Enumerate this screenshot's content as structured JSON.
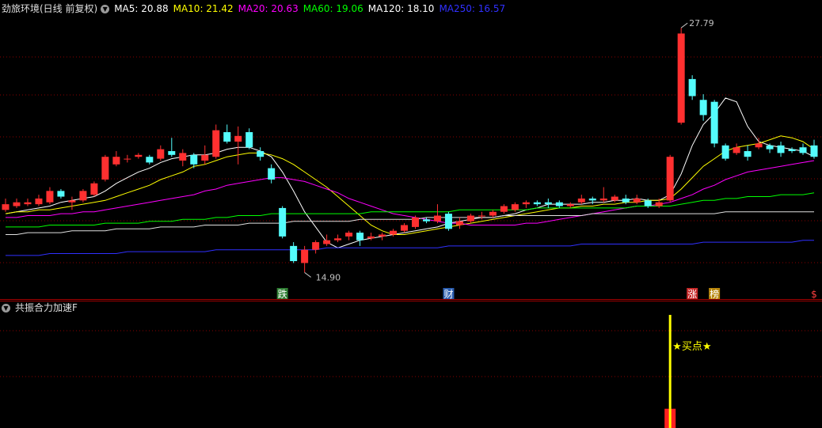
{
  "header": {
    "title": "劲旅环境(日线 前复权)",
    "ma_items": [
      {
        "label": "MA5: 20.88",
        "color": "#ffffff"
      },
      {
        "label": "MA10: 21.42",
        "color": "#ffff00"
      },
      {
        "label": "MA20: 20.63",
        "color": "#ff00ff"
      },
      {
        "label": "MA60: 19.06",
        "color": "#00ff00"
      },
      {
        "label": "MA120: 18.10",
        "color": "#ffffff"
      },
      {
        "label": "MA250: 16.57",
        "color": "#3030ff"
      }
    ]
  },
  "sub_header": {
    "title": "共振合力加速F"
  },
  "colors": {
    "up": "#ff3030",
    "down": "#54fcfc",
    "grid": "#8a0000",
    "signal": "#ffff00"
  },
  "chart_data": {
    "type": "candlestick",
    "price_range": [
      13.5,
      28.6
    ],
    "annotations": {
      "high": "27.79",
      "low": "14.90"
    },
    "event_markers": [
      {
        "index": 25,
        "text": "跌",
        "color": "#ffffff",
        "bg": "#2e7d32"
      },
      {
        "index": 40,
        "text": "财",
        "color": "#ffffff",
        "bg": "#2a5db0"
      },
      {
        "index": 62,
        "text": "涨",
        "color": "#ffffff",
        "bg": "#c62828"
      },
      {
        "index": 64,
        "text": "榜",
        "color": "#ffffff",
        "bg": "#b8860b"
      },
      {
        "index": 73,
        "text": "$",
        "color": "#ff4040",
        "bg": ""
      }
    ],
    "candles": [
      [
        18.2,
        18.5,
        18.8,
        18.1
      ],
      [
        18.4,
        18.6,
        18.8,
        18.3
      ],
      [
        18.5,
        18.6,
        18.8,
        18.4
      ],
      [
        18.5,
        18.8,
        19.0,
        18.4
      ],
      [
        18.6,
        19.2,
        19.4,
        18.5
      ],
      [
        19.2,
        18.9,
        19.3,
        18.8
      ],
      [
        18.6,
        18.7,
        18.9,
        18.2
      ],
      [
        18.7,
        19.2,
        19.3,
        18.6
      ],
      [
        19.0,
        19.6,
        19.7,
        18.9
      ],
      [
        19.8,
        21.0,
        21.1,
        19.7
      ],
      [
        20.6,
        21.0,
        21.3,
        20.5
      ],
      [
        20.9,
        20.9,
        21.1,
        20.7
      ],
      [
        21.0,
        21.1,
        21.2,
        20.9
      ],
      [
        21.0,
        20.7,
        21.1,
        20.6
      ],
      [
        20.9,
        21.4,
        21.6,
        20.8
      ],
      [
        21.3,
        21.1,
        22.0,
        21.0
      ],
      [
        20.8,
        21.2,
        21.4,
        20.5
      ],
      [
        21.1,
        20.6,
        21.2,
        20.4
      ],
      [
        20.8,
        21.1,
        21.6,
        20.6
      ],
      [
        21.0,
        22.4,
        22.7,
        20.9
      ],
      [
        22.3,
        21.8,
        22.7,
        21.7
      ],
      [
        21.8,
        22.1,
        22.6,
        20.6
      ],
      [
        22.3,
        21.5,
        22.5,
        21.4
      ],
      [
        21.3,
        21.0,
        21.5,
        20.8
      ],
      [
        20.4,
        19.8,
        20.6,
        19.6
      ],
      [
        18.3,
        16.8,
        18.4,
        16.7
      ],
      [
        16.3,
        15.5,
        16.5,
        15.4
      ],
      [
        15.4,
        16.1,
        16.3,
        14.9
      ],
      [
        16.1,
        16.5,
        16.6,
        15.9
      ],
      [
        16.4,
        16.6,
        16.9,
        16.3
      ],
      [
        16.6,
        16.7,
        16.9,
        16.5
      ],
      [
        16.8,
        17.0,
        17.1,
        16.6
      ],
      [
        17.0,
        16.6,
        17.1,
        16.3
      ],
      [
        16.7,
        16.8,
        17.0,
        16.6
      ],
      [
        16.8,
        16.9,
        17.0,
        16.6
      ],
      [
        16.9,
        17.1,
        17.2,
        16.8
      ],
      [
        17.1,
        17.4,
        17.5,
        17.0
      ],
      [
        17.3,
        17.8,
        17.9,
        17.2
      ],
      [
        17.7,
        17.6,
        17.8,
        17.5
      ],
      [
        17.6,
        17.9,
        18.5,
        17.5
      ],
      [
        18.0,
        17.2,
        18.1,
        17.1
      ],
      [
        17.4,
        17.6,
        17.8,
        17.2
      ],
      [
        17.6,
        17.9,
        18.0,
        17.5
      ],
      [
        17.9,
        17.9,
        18.1,
        17.7
      ],
      [
        17.9,
        18.1,
        18.2,
        17.8
      ],
      [
        18.1,
        18.4,
        18.5,
        18.0
      ],
      [
        18.2,
        18.5,
        18.6,
        18.1
      ],
      [
        18.5,
        18.6,
        18.7,
        18.3
      ],
      [
        18.6,
        18.5,
        18.7,
        18.4
      ],
      [
        18.6,
        18.5,
        18.8,
        18.3
      ],
      [
        18.6,
        18.4,
        18.7,
        18.3
      ],
      [
        18.4,
        18.5,
        18.6,
        18.3
      ],
      [
        18.6,
        18.8,
        19.0,
        18.5
      ],
      [
        18.8,
        18.7,
        18.9,
        18.5
      ],
      [
        18.7,
        18.8,
        19.4,
        18.6
      ],
      [
        18.7,
        18.9,
        19.0,
        18.6
      ],
      [
        18.8,
        18.6,
        19.0,
        18.5
      ],
      [
        18.6,
        18.8,
        19.0,
        18.5
      ],
      [
        18.7,
        18.4,
        18.8,
        18.3
      ],
      [
        18.4,
        18.6,
        18.8,
        18.3
      ],
      [
        18.7,
        21.0,
        21.1,
        18.6
      ],
      [
        22.8,
        27.5,
        27.8,
        22.7
      ],
      [
        25.1,
        24.2,
        25.3,
        24.0
      ],
      [
        24.0,
        23.2,
        24.3,
        22.9
      ],
      [
        23.9,
        21.7,
        24.0,
        21.5
      ],
      [
        21.6,
        20.9,
        21.7,
        20.8
      ],
      [
        21.2,
        21.5,
        21.7,
        21.1
      ],
      [
        21.3,
        21.0,
        21.6,
        20.8
      ],
      [
        21.5,
        21.7,
        22.0,
        21.4
      ],
      [
        21.6,
        21.4,
        21.7,
        21.2
      ],
      [
        21.6,
        21.2,
        21.8,
        21.0
      ],
      [
        21.4,
        21.3,
        21.5,
        21.2
      ],
      [
        21.5,
        21.2,
        21.7,
        21.1
      ],
      [
        21.6,
        21.0,
        21.9,
        20.9
      ]
    ],
    "ma_series": [
      {
        "color": "#ffffff",
        "values": [
          18.0,
          18.1,
          18.2,
          18.3,
          18.4,
          18.6,
          18.7,
          18.8,
          18.9,
          19.2,
          19.6,
          19.9,
          20.2,
          20.4,
          20.7,
          20.9,
          21.0,
          21.1,
          21.1,
          21.2,
          21.4,
          21.5,
          21.5,
          21.3,
          21.0,
          20.2,
          19.2,
          18.1,
          17.3,
          16.5,
          16.2,
          16.4,
          16.6,
          16.7,
          16.8,
          16.9,
          17.0,
          17.1,
          17.2,
          17.3,
          17.5,
          17.6,
          17.7,
          17.8,
          17.8,
          17.9,
          18.0,
          18.2,
          18.3,
          18.5,
          18.5,
          18.5,
          18.5,
          18.6,
          18.6,
          18.7,
          18.7,
          18.8,
          18.7,
          18.7,
          19.0,
          20.1,
          21.6,
          22.7,
          23.3,
          24.1,
          23.9,
          22.6,
          21.8,
          21.6,
          21.5,
          21.4,
          21.3,
          21.0
        ]
      },
      {
        "color": "#ffff00",
        "values": [
          18.0,
          18.1,
          18.1,
          18.2,
          18.2,
          18.3,
          18.4,
          18.5,
          18.6,
          18.7,
          18.9,
          19.1,
          19.3,
          19.5,
          19.8,
          20.0,
          20.2,
          20.5,
          20.6,
          20.8,
          21.0,
          21.1,
          21.2,
          21.2,
          21.1,
          20.9,
          20.6,
          20.2,
          19.8,
          19.4,
          18.9,
          18.4,
          17.9,
          17.4,
          17.1,
          16.9,
          16.9,
          17.0,
          17.1,
          17.2,
          17.3,
          17.4,
          17.5,
          17.6,
          17.7,
          17.8,
          17.9,
          18.0,
          18.1,
          18.2,
          18.3,
          18.3,
          18.4,
          18.4,
          18.5,
          18.5,
          18.6,
          18.6,
          18.7,
          18.7,
          18.8,
          19.3,
          19.9,
          20.5,
          20.9,
          21.3,
          21.5,
          21.6,
          21.7,
          21.9,
          22.1,
          22.0,
          21.8,
          21.4
        ]
      },
      {
        "color": "#ff00ff",
        "values": [
          17.8,
          17.8,
          17.9,
          17.9,
          17.9,
          18.0,
          18.0,
          18.1,
          18.1,
          18.2,
          18.3,
          18.4,
          18.5,
          18.6,
          18.7,
          18.8,
          18.9,
          19.0,
          19.2,
          19.3,
          19.5,
          19.6,
          19.7,
          19.8,
          19.9,
          19.9,
          19.8,
          19.7,
          19.5,
          19.3,
          19.1,
          18.8,
          18.6,
          18.4,
          18.2,
          18.0,
          17.9,
          17.8,
          17.7,
          17.6,
          17.5,
          17.5,
          17.4,
          17.4,
          17.4,
          17.4,
          17.4,
          17.5,
          17.5,
          17.6,
          17.7,
          17.8,
          17.9,
          18.0,
          18.1,
          18.2,
          18.3,
          18.4,
          18.4,
          18.5,
          18.6,
          18.8,
          19.0,
          19.3,
          19.5,
          19.8,
          20.0,
          20.2,
          20.3,
          20.4,
          20.5,
          20.6,
          20.7,
          20.8
        ]
      },
      {
        "color": "#00ff00",
        "values": [
          17.3,
          17.3,
          17.3,
          17.3,
          17.4,
          17.4,
          17.4,
          17.4,
          17.4,
          17.5,
          17.5,
          17.5,
          17.5,
          17.6,
          17.6,
          17.6,
          17.7,
          17.7,
          17.7,
          17.8,
          17.8,
          17.9,
          17.9,
          17.9,
          18.0,
          18.0,
          18.0,
          18.0,
          18.0,
          18.0,
          18.0,
          18.0,
          18.0,
          18.1,
          18.1,
          18.1,
          18.1,
          18.1,
          18.1,
          18.1,
          18.1,
          18.2,
          18.2,
          18.2,
          18.2,
          18.2,
          18.2,
          18.2,
          18.3,
          18.3,
          18.3,
          18.3,
          18.3,
          18.3,
          18.3,
          18.3,
          18.3,
          18.4,
          18.4,
          18.4,
          18.4,
          18.5,
          18.6,
          18.7,
          18.7,
          18.8,
          18.8,
          18.9,
          18.9,
          18.9,
          19.0,
          19.0,
          19.0,
          19.1
        ]
      },
      {
        "color": "#e0e0e0",
        "values": [
          16.9,
          16.9,
          17.0,
          17.0,
          17.0,
          17.0,
          17.1,
          17.1,
          17.1,
          17.1,
          17.2,
          17.2,
          17.2,
          17.2,
          17.3,
          17.3,
          17.3,
          17.3,
          17.4,
          17.4,
          17.4,
          17.4,
          17.5,
          17.5,
          17.5,
          17.5,
          17.6,
          17.6,
          17.6,
          17.6,
          17.6,
          17.6,
          17.7,
          17.7,
          17.7,
          17.7,
          17.7,
          17.7,
          17.8,
          17.8,
          17.8,
          17.8,
          17.8,
          17.8,
          17.8,
          17.9,
          17.9,
          17.9,
          17.9,
          17.9,
          17.9,
          17.9,
          17.9,
          18.0,
          18.0,
          18.0,
          18.0,
          18.0,
          18.0,
          18.0,
          18.0,
          18.0,
          18.0,
          18.0,
          18.0,
          18.1,
          18.1,
          18.1,
          18.1,
          18.1,
          18.1,
          18.1,
          18.1,
          18.1
        ]
      },
      {
        "color": "#3030ff",
        "values": [
          15.8,
          15.8,
          15.8,
          15.8,
          15.9,
          15.9,
          15.9,
          15.9,
          15.9,
          15.9,
          15.9,
          16.0,
          16.0,
          16.0,
          16.0,
          16.0,
          16.0,
          16.0,
          16.0,
          16.1,
          16.1,
          16.1,
          16.1,
          16.1,
          16.1,
          16.1,
          16.1,
          16.1,
          16.1,
          16.2,
          16.2,
          16.2,
          16.2,
          16.2,
          16.2,
          16.2,
          16.2,
          16.2,
          16.2,
          16.2,
          16.3,
          16.3,
          16.3,
          16.3,
          16.3,
          16.3,
          16.3,
          16.3,
          16.3,
          16.3,
          16.3,
          16.3,
          16.4,
          16.4,
          16.4,
          16.4,
          16.4,
          16.4,
          16.4,
          16.4,
          16.4,
          16.4,
          16.4,
          16.5,
          16.5,
          16.5,
          16.5,
          16.5,
          16.5,
          16.5,
          16.5,
          16.5,
          16.6,
          16.6
        ]
      }
    ],
    "indicator": {
      "signal_index": 60,
      "label": "★买点★",
      "line_value": 1.0,
      "bar_value": 0.17
    }
  }
}
